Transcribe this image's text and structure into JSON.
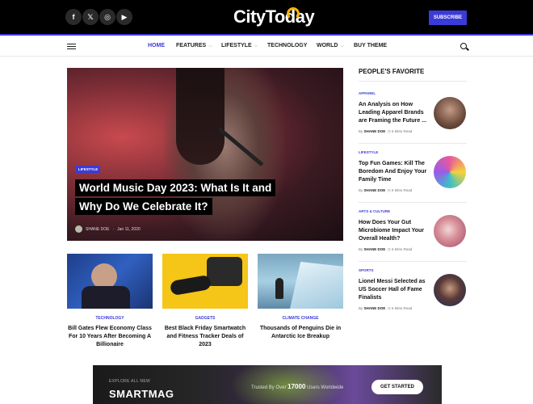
{
  "header": {
    "logo": "CityToday",
    "subscribe_label": "SUBSCRIBE",
    "social_icons": [
      "facebook-icon",
      "x-icon",
      "instagram-icon",
      "youtube-icon"
    ],
    "social_glyphs": [
      "f",
      "𝕏",
      "◎",
      "▶"
    ]
  },
  "nav": {
    "items": [
      {
        "label": "HOME",
        "active": true,
        "dropdown": false
      },
      {
        "label": "FEATURES",
        "active": false,
        "dropdown": true
      },
      {
        "label": "LIFESTYLE",
        "active": false,
        "dropdown": true
      },
      {
        "label": "TECHNOLOGY",
        "active": false,
        "dropdown": false
      },
      {
        "label": "WORLD",
        "active": false,
        "dropdown": true
      },
      {
        "label": "BUY THEME",
        "active": false,
        "dropdown": false
      }
    ]
  },
  "hero": {
    "category": "LIFESTYLE",
    "title_line1": "World Music Day 2023: What Is It and",
    "title_line2": "Why Do We Celebrate It?",
    "author": "SHANE DOE",
    "date": "Jan 11, 2020"
  },
  "cards": [
    {
      "category": "TECHNOLOGY",
      "title": "Bill Gates Flew Economy Class For 10 Years After Becoming A Billionaire"
    },
    {
      "category": "GADGETS",
      "title": "Best Black Friday Smartwatch and Fitness Tracker Deals of 2023"
    },
    {
      "category": "CLIMATE CHANGE",
      "title": "Thousands of Penguins Die in Antarctic Ice Breakup"
    }
  ],
  "sidebar": {
    "heading": "PEOPLE'S FAVORITE",
    "items": [
      {
        "category": "APPAREL",
        "title": "An Analysis on How Leading Apparel Brands are Framing the Future ...",
        "by": "By",
        "author": "SHANE DOE",
        "read": "6 Mins Read"
      },
      {
        "category": "LIFESTYLE",
        "title": "Top Fun Games: Kill The Boredom And Enjoy Your Family Time",
        "by": "By",
        "author": "SHANE DOE",
        "read": "6 Mins Read"
      },
      {
        "category": "ARTS & CULTURE",
        "title": "How Does Your Gut Microbiome Impact Your Overall Health?",
        "by": "By",
        "author": "SHANE DOE",
        "read": "6 Mins Read"
      },
      {
        "category": "SPORTS",
        "title": "Lionel Messi Selected as US Soccer Hall of Fame Finalists",
        "by": "By",
        "author": "SHANE DOE",
        "read": "6 Mins Read"
      }
    ]
  },
  "banner": {
    "small_text": "EXPLORE ALL NEW",
    "big_text": "SMARTMAG",
    "trust_prefix": "Trusted By Over",
    "trust_number": "17000",
    "trust_suffix": "Users Worldwide",
    "button_label": "GET STARTED"
  },
  "colors": {
    "accent": "#3b3bd9",
    "logo_accent": "#f5b400",
    "topbar": "#000000"
  }
}
